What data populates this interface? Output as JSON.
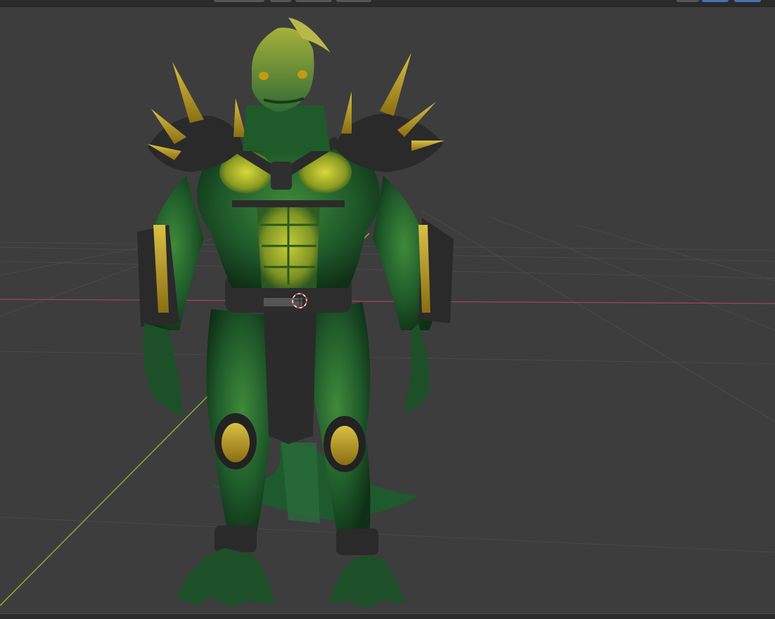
{
  "app": {
    "name": "3D Viewport",
    "background": "#3d3d3d"
  },
  "toolbar": {
    "buttons": [
      {
        "name": "mode-dropdown",
        "active": false
      },
      {
        "name": "viewport-shading-icon",
        "active": false
      },
      {
        "name": "snap-toggle",
        "active": false
      },
      {
        "name": "proportional-edit-toggle",
        "active": false
      },
      {
        "name": "overlay-dropdown",
        "active": false
      },
      {
        "name": "gizmo-toggle",
        "active": true
      },
      {
        "name": "xray-toggle",
        "active": true
      }
    ]
  },
  "scene": {
    "object": "lizard-warrior-character",
    "colors": {
      "skin_green": "#1f5a2a",
      "skin_highlight": "#c8c82a",
      "armor_dark": "#2a2a2a",
      "armor_gold": "#b39a1e",
      "x_axis": "#a8454b",
      "y_axis": "#7fa838",
      "grid": "#4f4f4f"
    },
    "icons": [
      "3d-cursor-icon"
    ]
  }
}
